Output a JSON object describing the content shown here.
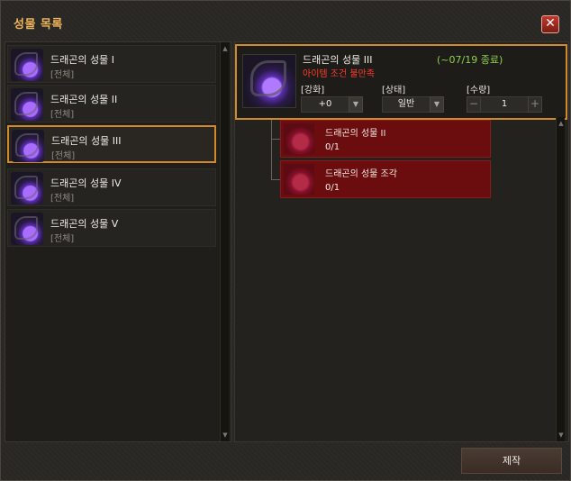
{
  "window": {
    "title": "성물 목록",
    "close_label": "✕"
  },
  "list": {
    "items": [
      {
        "name": "드래곤의 성물 I",
        "sub": "[전체]",
        "selected": false
      },
      {
        "name": "드래곤의 성물 II",
        "sub": "[전체]",
        "selected": false
      },
      {
        "name": "드래곤의 성물 III",
        "sub": "[전체]",
        "selected": true
      },
      {
        "name": "드래곤의 성물 IV",
        "sub": "[전체]",
        "selected": false
      },
      {
        "name": "드래곤의 성물 V",
        "sub": "[전체]",
        "selected": false
      }
    ]
  },
  "detail": {
    "name": "드래곤의 성물 III",
    "period": "(~07/19 종료)",
    "warning": "아이템 조건 불만족",
    "enhance_label": "[강화]",
    "enhance_value": "+0",
    "state_label": "[상태]",
    "state_value": "일반",
    "qty_label": "[수량]",
    "qty_value": "1",
    "qty_minus": "−",
    "qty_plus": "+"
  },
  "materials": [
    {
      "name": "드래곤의 성물 II",
      "count": "0/1"
    },
    {
      "name": "드래곤의 성물 조각",
      "count": "0/1"
    }
  ],
  "actions": {
    "craft_label": "제작"
  },
  "colors": {
    "accent": "#d08a2a",
    "title": "#f0b45a",
    "period": "#8fd14f",
    "warning": "#ff3b2a",
    "material_bg": "#6b0d0f"
  }
}
